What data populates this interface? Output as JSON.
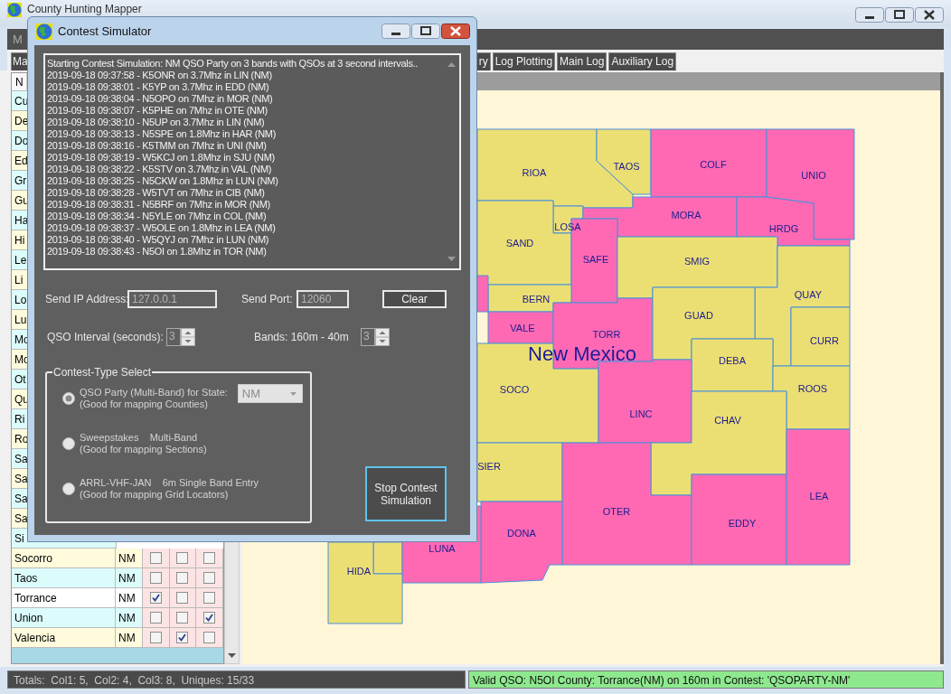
{
  "main_window": {
    "title": "County Hunting Mapper",
    "menu": [
      "M"
    ],
    "tabs": [
      "Ma",
      "ry",
      "Log Plotting",
      "Main Log",
      "Auxiliary Log"
    ]
  },
  "county_table": {
    "columns": [
      "N"
    ],
    "rows": [
      {
        "name": "Cu",
        "selected": false
      },
      {
        "name": "De",
        "selected": false
      },
      {
        "name": "Do",
        "selected": false
      },
      {
        "name": "Ed",
        "selected": false
      },
      {
        "name": "Gr",
        "selected": false
      },
      {
        "name": "Gu",
        "selected": false
      },
      {
        "name": "Ha",
        "selected": false
      },
      {
        "name": "Hi",
        "selected": false
      },
      {
        "name": "Le",
        "selected": false
      },
      {
        "name": "Li",
        "selected": false
      },
      {
        "name": "Lo",
        "selected": false
      },
      {
        "name": "Lu",
        "selected": false
      },
      {
        "name": "Mo",
        "selected": false
      },
      {
        "name": "Mo",
        "selected": false
      },
      {
        "name": "Ot",
        "selected": false
      },
      {
        "name": "Qu",
        "selected": false
      },
      {
        "name": "Ri",
        "selected": false
      },
      {
        "name": "Ro",
        "selected": false
      },
      {
        "name": "Sa",
        "selected": false
      },
      {
        "name": "Sa",
        "selected": false
      },
      {
        "name": "Sa",
        "selected": false
      },
      {
        "name": "Sa",
        "selected": false
      },
      {
        "name": "Si",
        "selected": false
      },
      {
        "name": "Socorro",
        "state": "NM",
        "checks": [
          false,
          false,
          false
        ],
        "selected": false
      },
      {
        "name": "Taos",
        "state": "NM",
        "checks": [
          false,
          false,
          false
        ],
        "selected": false
      },
      {
        "name": "Torrance",
        "state": "NM",
        "checks": [
          true,
          false,
          false
        ],
        "selected": true
      },
      {
        "name": "Union",
        "state": "NM",
        "checks": [
          false,
          false,
          true
        ],
        "selected": false
      },
      {
        "name": "Valencia",
        "state": "NM",
        "checks": [
          false,
          true,
          false
        ],
        "selected": false
      }
    ]
  },
  "map": {
    "state_label": "New Mexico",
    "counties": [
      {
        "label": "RIOA",
        "worked": false
      },
      {
        "label": "TAOS",
        "worked": false
      },
      {
        "label": "COLF",
        "worked": true
      },
      {
        "label": "UNIO",
        "worked": true
      },
      {
        "label": "LOSA",
        "worked": false
      },
      {
        "label": "MORA",
        "worked": true
      },
      {
        "label": "HRDG",
        "worked": true
      },
      {
        "label": "SAND",
        "worked": false
      },
      {
        "label": "SAFE",
        "worked": true
      },
      {
        "label": "SMIG",
        "worked": false
      },
      {
        "label": "QUAY",
        "worked": false
      },
      {
        "label": "BERN",
        "worked": false
      },
      {
        "label": "VALE",
        "worked": true
      },
      {
        "label": "TORR",
        "worked": true
      },
      {
        "label": "GUAD",
        "worked": false
      },
      {
        "label": "CURR",
        "worked": false
      },
      {
        "label": "DEBA",
        "worked": false
      },
      {
        "label": "ROOS",
        "worked": false
      },
      {
        "label": "SOCO",
        "worked": false
      },
      {
        "label": "LINC",
        "worked": true
      },
      {
        "label": "CHAV",
        "worked": false
      },
      {
        "label": "SIER",
        "worked": false
      },
      {
        "label": "OTER",
        "worked": true
      },
      {
        "label": "EDDY",
        "worked": true
      },
      {
        "label": "LEA",
        "worked": true
      },
      {
        "label": "DONA",
        "worked": true
      },
      {
        "worked": false
      },
      {
        "label": "LUNA",
        "worked": true
      },
      {
        "label": "HIDA",
        "worked": false
      },
      {
        "worked": true
      }
    ]
  },
  "status_bar": {
    "totals": "Totals:  Col1: 5,  Col2: 4,  Col3: 8,  Uniques: 15/33",
    "message": "Valid QSO: N5OI County: Torrance(NM) on 160m in Contest: 'QSOPARTY-NM'"
  },
  "dialog": {
    "title": "Contest Simulator",
    "log_lines": [
      "Starting Contest Simulation: NM QSO Party on 3 bands with QSOs at 3 second intervals..",
      "2019-09-18 09:37:58 - K5ONR on 3.7Mhz in LIN (NM)",
      "2019-09-18 09:38:01 - K5YP on 3.7Mhz in EDD (NM)",
      "2019-09-18 09:38:04 - N5OPO on 7Mhz in MOR (NM)",
      "2019-09-18 09:38:07 - K5PHE on 7Mhz in OTE (NM)",
      "2019-09-18 09:38:10 - N5UP on 3.7Mhz in LIN (NM)",
      "2019-09-18 09:38:13 - N5SPE on 1.8Mhz in HAR (NM)",
      "2019-09-18 09:38:16 - K5TMM on 7Mhz in UNI (NM)",
      "2019-09-18 09:38:19 - W5KCJ on 1.8Mhz in SJU (NM)",
      "2019-09-18 09:38:22 - K5STV on 3.7Mhz in VAL (NM)",
      "2019-09-18 09:38:25 - N5CKW on 1.8Mhz in LUN (NM)",
      "2019-09-18 09:38:28 - W5TVT on 7Mhz in CIB (NM)",
      "2019-09-18 09:38:31 - N5BRF on 7Mhz in MOR (NM)",
      "2019-09-18 09:38:34 - N5YLE on 7Mhz in COL (NM)",
      "2019-09-18 09:38:37 - W5OLE on 1.8Mhz in LEA (NM)",
      "2019-09-18 09:38:40 - W5QYJ on 7Mhz in LUN (NM)",
      "2019-09-18 09:38:43 - N5OI on 1.8Mhz in TOR (NM)"
    ],
    "send_ip": {
      "label": "Send IP Address:",
      "value": "127.0.0.1",
      "disabled": true
    },
    "send_port": {
      "label": "Send Port:",
      "value": "12060",
      "disabled": true
    },
    "clear_button": "Clear",
    "interval": {
      "label": "QSO Interval (seconds):",
      "value": "3",
      "disabled": true
    },
    "bands": {
      "label": "Bands: 160m - 40m",
      "value": "3",
      "disabled": true
    },
    "group_title": "Contest-Type Select",
    "options": [
      {
        "label": "QSO Party (Multi-Band) for State:",
        "hint": "(Good for mapping Counties)",
        "selected": true,
        "state": "NM"
      },
      {
        "label": "Sweepstakes    Multi-Band",
        "hint": "(Good for mapping Sections)",
        "selected": false
      },
      {
        "label": "ARRL-VHF-JAN    6m Single Band Entry",
        "hint": "(Good for mapping Grid Locators)",
        "selected": false
      }
    ],
    "stop_button": "Stop Contest Simulation"
  }
}
